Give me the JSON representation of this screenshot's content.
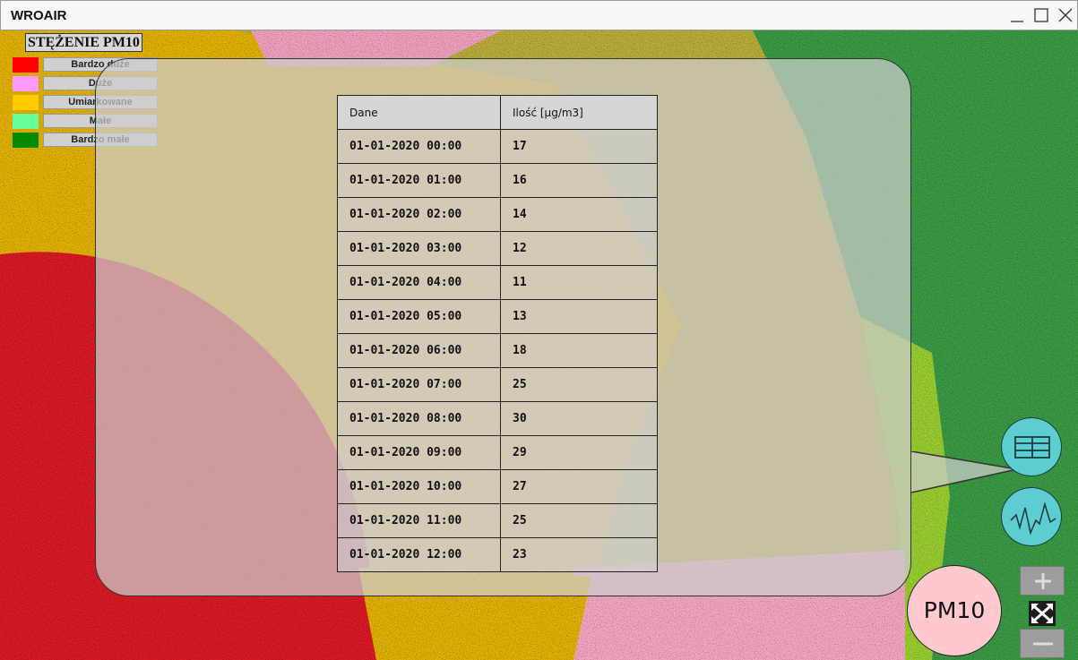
{
  "window": {
    "title": "WROAIR"
  },
  "legend": {
    "title": "STĘŻENIE PM10",
    "items": [
      {
        "label": "Bardzo duże",
        "color": "#ff0000"
      },
      {
        "label": "Duże",
        "color": "#ff99ff"
      },
      {
        "label": "Umiarkowane",
        "color": "#ffcc00"
      },
      {
        "label": "Małe",
        "color": "#66ff99"
      },
      {
        "label": "Bardzo małe",
        "color": "#008a00"
      }
    ]
  },
  "table": {
    "headers": [
      "Dane",
      "Ilość [µg/m3]"
    ],
    "rows": [
      [
        "01-01-2020 00:00",
        "17"
      ],
      [
        "01-01-2020 01:00",
        "16"
      ],
      [
        "01-01-2020 02:00",
        "14"
      ],
      [
        "01-01-2020 03:00",
        "12"
      ],
      [
        "01-01-2020 04:00",
        "11"
      ],
      [
        "01-01-2020 05:00",
        "13"
      ],
      [
        "01-01-2020 06:00",
        "18"
      ],
      [
        "01-01-2020 07:00",
        "25"
      ],
      [
        "01-01-2020 08:00",
        "30"
      ],
      [
        "01-01-2020 09:00",
        "29"
      ],
      [
        "01-01-2020 10:00",
        "27"
      ],
      [
        "01-01-2020 11:00",
        "25"
      ],
      [
        "01-01-2020 12:00",
        "23"
      ]
    ]
  },
  "controls": {
    "pollutant": "PM10",
    "table_view_icon": "table-icon",
    "chart_view_icon": "line-chart-icon",
    "zoom_in_icon": "plus-icon",
    "zoom_out_icon": "minus-icon",
    "fullscreen_icon": "fullscreen-icon"
  }
}
